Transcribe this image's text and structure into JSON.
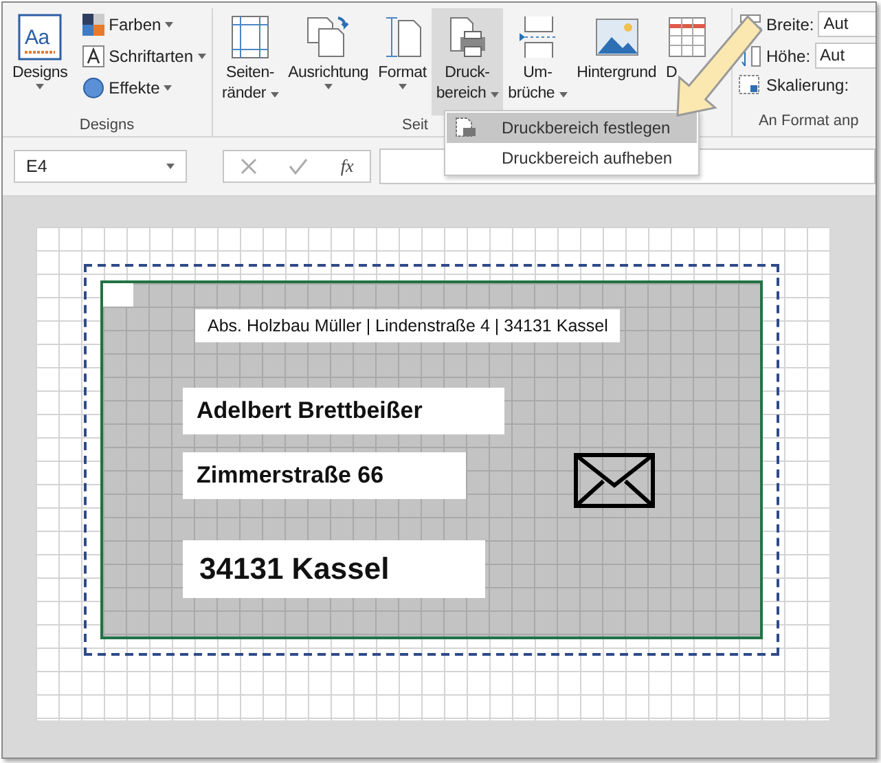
{
  "ribbon": {
    "designs_group": {
      "label": "Designs",
      "main_button": {
        "label": "Designs",
        "icon_text": "Aa",
        "has_menu": true
      },
      "items": [
        {
          "kind": "colors",
          "label": "Farben",
          "has_menu": true
        },
        {
          "kind": "fonts",
          "label": "Schriftarten",
          "has_menu": true
        },
        {
          "kind": "effects",
          "label": "Effekte",
          "has_menu": true
        }
      ]
    },
    "page_setup_group": {
      "label": "Seit",
      "buttons": [
        {
          "kind": "margins",
          "lines": [
            "Seiten-",
            "ränder"
          ],
          "has_menu": true,
          "selected": false
        },
        {
          "kind": "orientation",
          "lines": [
            "Ausrichtung"
          ],
          "has_menu": true,
          "selected": false
        },
        {
          "kind": "size",
          "lines": [
            "Format"
          ],
          "has_menu": true,
          "selected": false
        },
        {
          "kind": "print_area",
          "lines": [
            "Druck-",
            "bereich"
          ],
          "has_menu": true,
          "selected": true
        },
        {
          "kind": "breaks",
          "lines": [
            "Um-",
            "brüche"
          ],
          "has_menu": true,
          "selected": false
        },
        {
          "kind": "background",
          "lines": [
            "Hintergrund"
          ],
          "has_menu": false,
          "selected": false
        },
        {
          "kind": "titles",
          "lines": [
            "D"
          ],
          "has_menu": false,
          "selected": false
        }
      ]
    },
    "scale_group": {
      "label": "An Format anp",
      "fields": [
        {
          "kind": "width",
          "label": "Breite:",
          "value": "Aut"
        },
        {
          "kind": "height",
          "label": "Höhe:",
          "value": "Aut"
        },
        {
          "kind": "scale",
          "label": "Skalierung:"
        }
      ]
    }
  },
  "dropdown": {
    "items": [
      {
        "label": "Druckbereich festlegen",
        "selected": true,
        "icon": true
      },
      {
        "label": "Druckbereich aufheben",
        "selected": false,
        "icon": false
      }
    ]
  },
  "formula_bar": {
    "name_box": "E4",
    "fx": "fx"
  },
  "sheet": {
    "lines": [
      {
        "kind": "sender",
        "text": "Abs. Holzbau Müller | Lindenstraße 4 | 34131 Kassel"
      },
      {
        "kind": "name",
        "text": "Adelbert Brettbeißer"
      },
      {
        "kind": "street",
        "text": "Zimmerstraße 66"
      },
      {
        "kind": "city",
        "text": "34131 Kassel"
      }
    ]
  }
}
